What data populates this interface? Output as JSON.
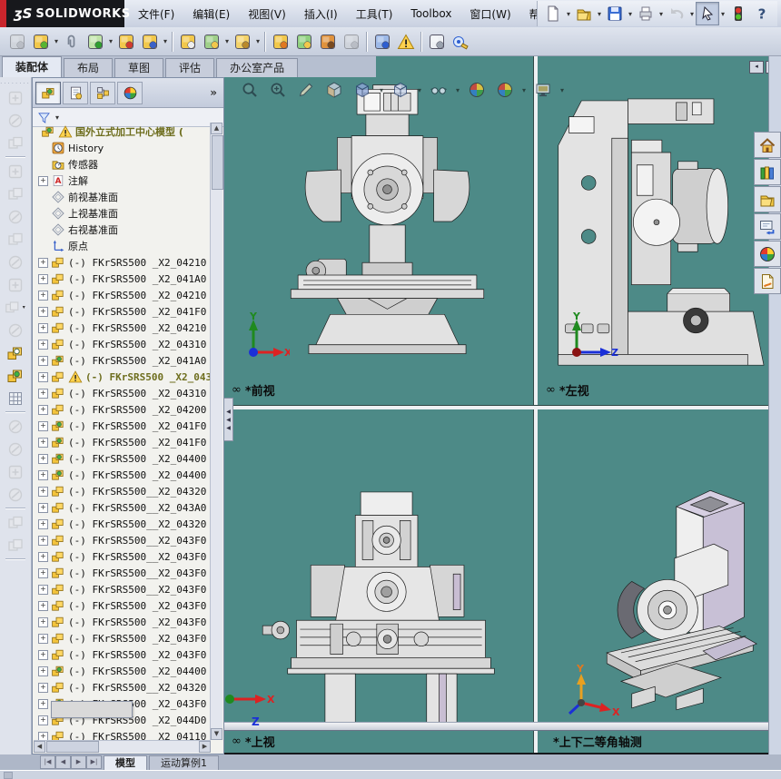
{
  "theme": {
    "viewport_bg": "#4d8a87",
    "accent_red": "#c9252c",
    "chrome": "#d3d9e5",
    "gold": "#f2c84b"
  },
  "titlebar": {
    "logo": "ʒS",
    "brand": "SOLIDWORKS"
  },
  "menus": [
    "文件(F)",
    "编辑(E)",
    "视图(V)",
    "插入(I)",
    "工具(T)",
    "Toolbox",
    "窗口(W)",
    "帮助(H)"
  ],
  "quickbar": [
    {
      "name": "new-document-icon",
      "kind": "doc",
      "dd": true
    },
    {
      "name": "open-icon",
      "kind": "open",
      "dd": true
    },
    {
      "name": "save-icon",
      "kind": "save",
      "dd": true
    },
    {
      "name": "print-icon",
      "kind": "print",
      "dd": true
    },
    {
      "name": "undo-icon",
      "kind": "undo",
      "dd": true,
      "disabled": true
    },
    {
      "name": "select-cursor-icon",
      "kind": "cursor",
      "dd": true,
      "pressed": true
    },
    {
      "name": "performance-traffic-light-icon",
      "kind": "traffic"
    },
    {
      "name": "help-icon",
      "kind": "help"
    }
  ],
  "assembly_toolbar": [
    {
      "name": "edit-component-icon",
      "c1": "#cdd2da",
      "c2": "#9aa2ae",
      "disabled": true
    },
    {
      "name": "insert-components-icon",
      "c1": "#f2c84b",
      "c2": "#58b531",
      "dd": true
    },
    {
      "name": "mate-icon",
      "kind": "clip"
    },
    {
      "name": "linear-component-pattern-icon",
      "c1": "#bfe3a8",
      "c2": "#2f9e2f",
      "dd": true
    },
    {
      "name": "smart-fasteners-icon",
      "c1": "#f2c84b",
      "c2": "#d23b2e"
    },
    {
      "name": "move-component-icon",
      "c1": "#f2c84b",
      "c2": "#3a62c9",
      "dd": true,
      "sep": true
    },
    {
      "name": "show-hidden-components-icon",
      "c1": "#f2c84b",
      "c2": "#efefef"
    },
    {
      "name": "assembly-features-icon",
      "c1": "#9fd08a",
      "c2": "#f2c84b",
      "dd": true
    },
    {
      "name": "reference-geometry-icon",
      "c1": "#f4d36a",
      "c2": "#b98a2c",
      "dd": true,
      "sep": true
    },
    {
      "name": "new-motion-study-icon",
      "c1": "#f2c84b",
      "c2": "#e07820"
    },
    {
      "name": "exploded-view-icon",
      "c1": "#8fd07f",
      "c2": "#f2c84b"
    },
    {
      "name": "explode-line-sketch-icon",
      "c1": "#e0923c",
      "c2": "#7a4a1e"
    },
    {
      "name": "interference-detection-icon",
      "c1": "#cdd2da",
      "c2": "#9aa2ae",
      "disabled": true,
      "sep": true
    },
    {
      "name": "large-assembly-mode-icon",
      "c1": "#9db9e8",
      "c2": "#2f5fd0"
    },
    {
      "name": "rebuild-warning-icon",
      "kind": "warn",
      "sep": true
    },
    {
      "name": "document-preview-icon",
      "c1": "#eef1f5",
      "c2": "#9aa2ae"
    },
    {
      "name": "measure-icon",
      "kind": "measure"
    }
  ],
  "command_tabs": [
    {
      "label": "装配体",
      "active": true
    },
    {
      "label": "布局",
      "active": false
    },
    {
      "label": "草图",
      "active": false
    },
    {
      "label": "评估",
      "active": false
    },
    {
      "label": "办公室产品",
      "active": false
    }
  ],
  "left_rail": [
    {
      "name": "hide-components-icon",
      "v": 0
    },
    {
      "name": "change-transparency-icon",
      "v": 1
    },
    {
      "name": "isolate-component-icon",
      "v": 2,
      "sep": true
    },
    {
      "name": "move-component-icon",
      "v": 0
    },
    {
      "name": "edit-surface-icon",
      "v": 2
    },
    {
      "name": "magnet-mate-icon",
      "v": 1
    },
    {
      "name": "flexible-icon",
      "v": 2
    },
    {
      "name": "clamp-icon",
      "v": 1
    },
    {
      "name": "plane-tool-icon",
      "v": 0
    },
    {
      "name": "component-stack-icon",
      "v": 2,
      "dd": true
    },
    {
      "name": "fix-component-icon",
      "v": 1
    },
    {
      "name": "part-block-white-icon",
      "kind": "blocks",
      "dot": "#ffffff"
    },
    {
      "name": "part-block-green-icon",
      "kind": "blocks",
      "dot": "#3db53d"
    },
    {
      "name": "pattern-grid-icon",
      "kind": "grid",
      "sep": true
    },
    {
      "name": "insert-below-icon",
      "v": 1
    },
    {
      "name": "insert-above-icon",
      "v": 1
    },
    {
      "name": "component-tray-icon",
      "v": 0
    },
    {
      "name": "material-sphere-icon",
      "v": 1,
      "sep": true
    },
    {
      "name": "surface-leaf-icon",
      "v": 2
    },
    {
      "name": "surface-leaf-2-icon",
      "v": 2,
      "sep": true
    }
  ],
  "tree": {
    "header_buttons": [
      {
        "name": "featuremanager-tab-icon",
        "kind": "blocks",
        "dot": "#3db53d",
        "active": true
      },
      {
        "name": "propertymanager-tab-icon",
        "kind": "page2",
        "active": false
      },
      {
        "name": "configurationmanager-tab-icon",
        "kind": "config",
        "active": false
      },
      {
        "name": "displaymanager-tab-icon",
        "kind": "ball",
        "active": false
      }
    ],
    "more_glyph": "»",
    "filter": {
      "icon": "filter-funnel-icon",
      "caret": "▾"
    },
    "root": {
      "label": "国外立式加工中心模型 (",
      "warning": true
    },
    "folders": [
      {
        "label": "History",
        "kind": "clock",
        "expand": false
      },
      {
        "label": "传感器",
        "kind": "sensors",
        "expand": false
      },
      {
        "label": "注解",
        "kind": "annA",
        "expand": true
      },
      {
        "label": "前视基准面",
        "kind": "plane",
        "expand": false
      },
      {
        "label": "上视基准面",
        "kind": "plane",
        "expand": false
      },
      {
        "label": "右视基准面",
        "kind": "plane",
        "expand": false
      },
      {
        "label": "原点",
        "kind": "origin",
        "expand": false
      }
    ],
    "components": [
      {
        "text": "(-) FKrSRS500 _X2_04210"
      },
      {
        "text": "(-) FKrSRS500 _X2_041A0"
      },
      {
        "text": "(-) FKrSRS500 _X2_04210"
      },
      {
        "text": "(-) FKrSRS500 _X2_041F0"
      },
      {
        "text": "(-) FKrSRS500 _X2_04210"
      },
      {
        "text": "(-) FKrSRS500 _X2_04310"
      },
      {
        "text": "(-) FKrSRS500 _X2_041A0",
        "green": true
      },
      {
        "text": "(-) FKrSRS500 _X2_043",
        "warn": true
      },
      {
        "text": "(-) FKrSRS500 _X2_04310"
      },
      {
        "text": "(-) FKrSRS500 _X2_04200"
      },
      {
        "text": "(-) FKrSRS500 _X2_041F0",
        "green": true
      },
      {
        "text": "(-) FKrSRS500 _X2_041F0",
        "green": true
      },
      {
        "text": "(-) FKrSRS500 _X2_04400",
        "green": true
      },
      {
        "text": "(-) FKrSRS500 _X2_04400",
        "green": true
      },
      {
        "text": "(-) FKrSRS500__X2_04320"
      },
      {
        "text": "(-) FKrSRS500__X2_043A0"
      },
      {
        "text": "(-) FKrSRS500__X2_04320"
      },
      {
        "text": "(-) FKrSRS500__X2_043F0"
      },
      {
        "text": "(-) FKrSRS500__X2_043F0"
      },
      {
        "text": "(-) FKrSRS500__X2_043F0"
      },
      {
        "text": "(-) FKrSRS500__X2_043F0"
      },
      {
        "text": "(-) FKrSRS500 _X2_043F0"
      },
      {
        "text": "(-) FKrSRS500 _X2_043F0"
      },
      {
        "text": "(-) FKrSRS500 _X2_043F0"
      },
      {
        "text": "(-) FKrSRS500 _X2_043F0"
      },
      {
        "text": "(-) FKrSRS500 _X2_04400",
        "green": true
      },
      {
        "text": "(-) FKrSRS500__X2_04320"
      },
      {
        "text": "(-) FKrSRS500 _X2_043F0",
        "green": true
      },
      {
        "text": "(-) FKrSRS500 _X2_044D0"
      },
      {
        "text": "(-) FKrSRS500 _X2_04110"
      }
    ]
  },
  "headsup": [
    {
      "name": "zoom-to-fit-icon",
      "kind": "mag"
    },
    {
      "name": "zoom-to-area-icon",
      "kind": "magp"
    },
    {
      "name": "previous-view-icon",
      "kind": "pencil"
    },
    {
      "name": "section-view-icon",
      "kind": "section"
    },
    {
      "name": "view-orientation-icon",
      "kind": "cube",
      "dd": true
    },
    {
      "name": "display-style-icon",
      "kind": "cube2",
      "dd": true
    },
    {
      "name": "hide-show-items-icon",
      "kind": "glasses",
      "dd": true
    },
    {
      "name": "edit-appearance-icon",
      "kind": "ball"
    },
    {
      "name": "apply-scene-icon",
      "kind": "ball",
      "dd": true
    },
    {
      "name": "view-settings-icon",
      "kind": "monitor",
      "dd": true
    }
  ],
  "viewports": {
    "front": {
      "label": "*前视",
      "link": "∞",
      "axes": {
        "y": "Y",
        "x": "X"
      }
    },
    "left": {
      "label": "*左视",
      "link": "∞",
      "axes": {
        "y": "Y",
        "z": "Z"
      }
    },
    "top": {
      "label": "*上视",
      "link": "∞",
      "axis_hint": "Z",
      "axes": {
        "x": "X"
      }
    },
    "iso": {
      "label": "*上下二等角轴测",
      "axes": {
        "y": "Y",
        "x": "X"
      }
    }
  },
  "corner_buttons": {
    "left_glyph": "◂",
    "right_glyph": "◂"
  },
  "taskpane": [
    {
      "name": "solidworks-resources-icon",
      "kind": "home"
    },
    {
      "name": "design-library-icon",
      "kind": "books"
    },
    {
      "name": "file-explorer-icon",
      "kind": "open"
    },
    {
      "name": "search-icon",
      "kind": "searchwin"
    },
    {
      "name": "view-palette-icon",
      "kind": "ball"
    },
    {
      "name": "appearances-icon",
      "kind": "page"
    }
  ],
  "bottom": {
    "nav": [
      "|◀",
      "◀",
      "▶",
      "▶|"
    ],
    "tabs": [
      {
        "label": "模型",
        "active": true
      },
      {
        "label": "运动算例1",
        "active": false
      }
    ]
  }
}
